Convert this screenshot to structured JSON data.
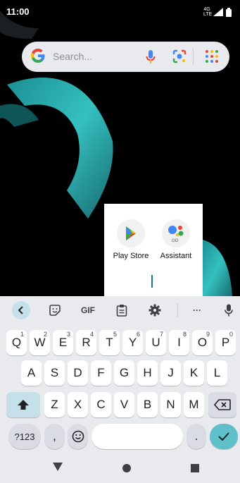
{
  "status": {
    "time": "11:00",
    "network_label": "4G LTE"
  },
  "search": {
    "placeholder": "Search..."
  },
  "popup": {
    "apps": [
      {
        "label": "Play Store"
      },
      {
        "label": "Assistant",
        "badge": "GO"
      }
    ]
  },
  "keyboard": {
    "toolbar": {
      "gif_label": "GIF",
      "more_label": "···"
    },
    "row1": [
      {
        "key": "Q",
        "hint": "1"
      },
      {
        "key": "W",
        "hint": "2"
      },
      {
        "key": "E",
        "hint": "3"
      },
      {
        "key": "R",
        "hint": "4"
      },
      {
        "key": "T",
        "hint": "5"
      },
      {
        "key": "Y",
        "hint": "6"
      },
      {
        "key": "U",
        "hint": "7"
      },
      {
        "key": "I",
        "hint": "8"
      },
      {
        "key": "O",
        "hint": "9"
      },
      {
        "key": "P",
        "hint": "0"
      }
    ],
    "row2": [
      "A",
      "S",
      "D",
      "F",
      "G",
      "H",
      "J",
      "K",
      "L"
    ],
    "row3": [
      "Z",
      "X",
      "C",
      "V",
      "B",
      "N",
      "M"
    ],
    "symbols_label": "?123",
    "comma_label": ",",
    "period_label": "."
  },
  "colors": {
    "accent": "#5fc0c9",
    "wallpaper_ring": "#2fb3b5"
  }
}
